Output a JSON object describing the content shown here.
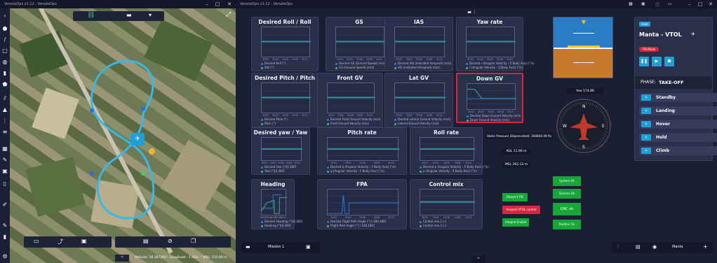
{
  "left_window": {
    "title": "VenoteOps v1.12 - VenoteOps",
    "status_bar": "Altitude: 28.387292°, Longitude: -1.314...° MSL: 235.00 m"
  },
  "right_window": {
    "title": "VenoteOps v1.12 - VenoteOps"
  },
  "charts": {
    "roll": {
      "title": "Desired Roll / Roll",
      "legend": [
        "Desired Roll (°)",
        "Roll (°)"
      ]
    },
    "gs": {
      "title": "GS",
      "legend": [
        "Desired GS (Ground Speed) (m/s)",
        "GS (Ground Speed) (m/s)"
      ]
    },
    "ias": {
      "title": "IAS",
      "legend": [
        "Desired IAS (Indicated Airspeed) (m/s)",
        "IAS (Indicated Airspeed) (m/s)"
      ]
    },
    "yawrate": {
      "title": "Yaw rate",
      "legend": [
        "Desired r (Angular Velocity - Z Body Axis) (°/s)",
        "r (Angular Velocity - Z Body Axis) (°/s)"
      ]
    },
    "pitch": {
      "title": "Desired Pitch / Pitch",
      "legend": [
        "Desired Pitch (°)",
        "Pitch (°)"
      ]
    },
    "frontgv": {
      "title": "Front GV",
      "legend": [
        "Desired Front Ground Velocity (m/s)",
        "Front Ground Velocity (m/s)"
      ]
    },
    "latgv": {
      "title": "Lat GV",
      "legend": [
        "Desired Lateral Ground Velocity (m/s)",
        "Lateral Ground Velocity (m/s)"
      ]
    },
    "downgv": {
      "title": "Down GV",
      "legend": [
        "Desired Down Ground Velocity (m/s)",
        "Down Ground Velocity (m/s)"
      ]
    },
    "yaw": {
      "title": "Desired yaw / Yaw",
      "legend": [
        "Desired Yaw (°)[0,360]",
        "Yaw (°)[0,360]"
      ]
    },
    "pitchrate": {
      "title": "Pitch rate",
      "legend": [
        "Desired q (Angular Velocity - Y Body Axis) (°/s)",
        "q (Angular Velocity - Y Body Axis) (°/s)"
      ]
    },
    "rollrate": {
      "title": "Roll rate",
      "legend": [
        "Desired p (Angular Velocity - X Body Axis) (°/s)",
        "p (Angular Velocity - X Body Axis) (°/s)"
      ]
    },
    "heading": {
      "title": "Heading",
      "legend": [
        "Desired Heading (°)[0,360]",
        "Heading (°)[0,360]"
      ]
    },
    "fpa": {
      "title": "FPA",
      "legend": [
        "Desired Flight Path Angle (°) [-180,180]",
        "Flight Path Angle (°) [-180,180]"
      ]
    },
    "controlmix": {
      "title": "Control mix",
      "legend": [
        "Control mix 1 (-)",
        "Control mix 2 (-)"
      ]
    }
  },
  "time_ticks": [
    "3002",
    "3004",
    "3006",
    "3008",
    "3010"
  ],
  "yaw_label": "Yaw 174.86",
  "static_pressure": "Static Pressure (Deprecated): 100844.09 Pa",
  "agl": "AGL 11.90 m",
  "msl": "MSL 262.13 m",
  "status_buttons": {
    "respect_fw": "Respect FW",
    "respect_vtol": "Respect VTOL control",
    "integral": "Integral Enable"
  },
  "health": [
    "System Ok",
    "Sensors Ok",
    "GNC ok",
    "Position Fix"
  ],
  "vehicle": {
    "badge": "Auto",
    "name": "Manta - VTOL",
    "mode_chip": "FW Mode",
    "phase_label": "PHASE:",
    "phase_value": "TAKE-OFF",
    "actions": [
      "Standby",
      "Landing",
      "Hover",
      "Hold",
      "Climb"
    ]
  },
  "bottom_bar": {
    "mission": "Mission 1",
    "mode": "Manta"
  },
  "colors": {
    "accent": "#1e9fd8",
    "danger": "#d7263d",
    "ok": "#17a83a"
  }
}
